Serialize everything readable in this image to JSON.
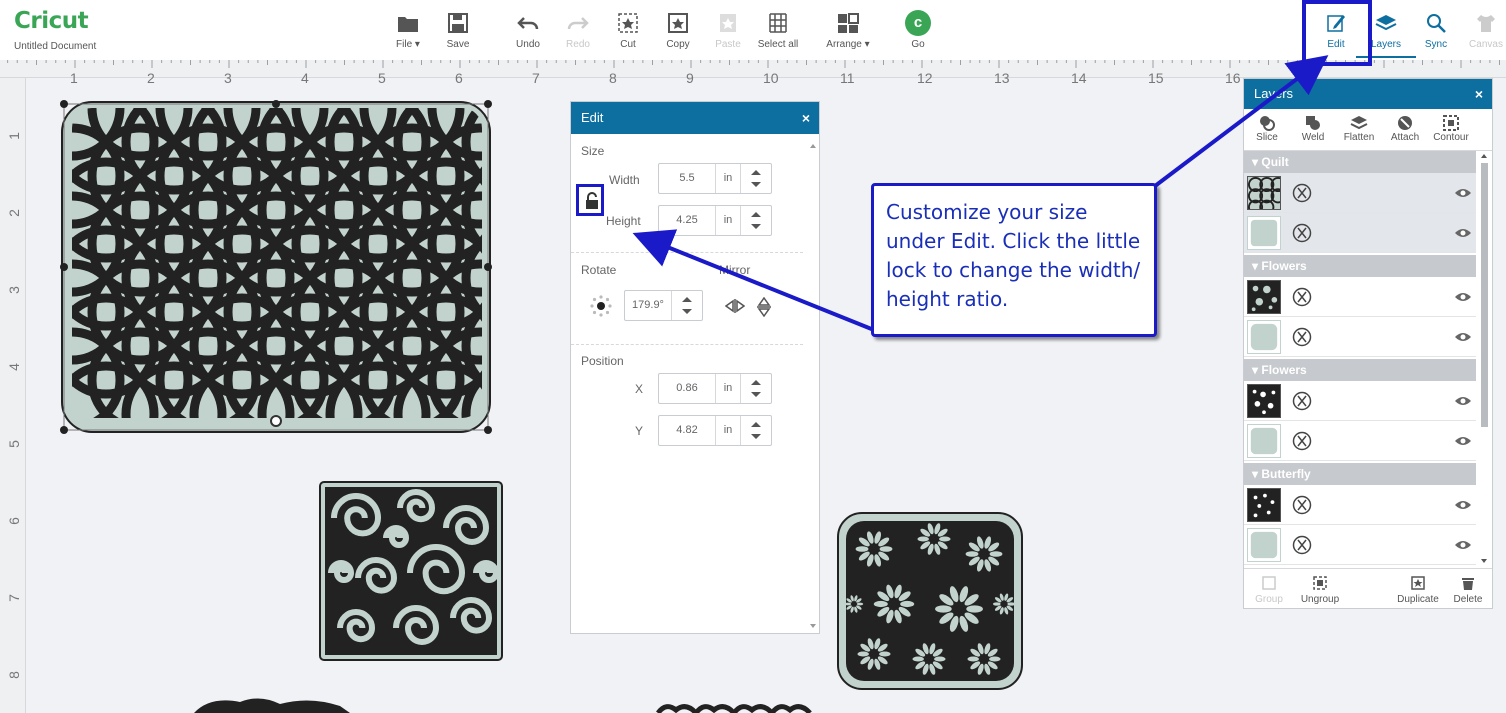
{
  "app": {
    "logo": "Cricut",
    "document_name": "Untitled Document"
  },
  "toolbar": {
    "file": "File",
    "save": "Save",
    "undo": "Undo",
    "redo": "Redo",
    "cut": "Cut",
    "copy": "Copy",
    "paste": "Paste",
    "select_all": "Select all",
    "arrange": "Arrange",
    "go": "Go",
    "go_glyph": "c",
    "edit": "Edit",
    "layers": "Layers",
    "sync": "Sync",
    "canvas": "Canvas"
  },
  "ruler": {
    "h_numbers": [
      "1",
      "2",
      "3",
      "4",
      "5",
      "6",
      "7",
      "8",
      "9",
      "10",
      "11",
      "12",
      "13",
      "14",
      "15",
      "16"
    ],
    "v_numbers": [
      "1",
      "2",
      "3",
      "4",
      "5",
      "6",
      "7",
      "8"
    ]
  },
  "edit_panel": {
    "title": "Edit",
    "close": "×",
    "size_title": "Size",
    "width_label": "Width",
    "width_value": "5.5",
    "height_label": "Height",
    "height_value": "4.25",
    "unit": "in",
    "rotate_title": "Rotate",
    "rotate_value": "179.9°",
    "mirror_title": "Mirror",
    "position_title": "Position",
    "x_label": "X",
    "x_value": "0.86",
    "y_label": "Y",
    "y_value": "4.82"
  },
  "layers_panel": {
    "title": "Layers",
    "close": "×",
    "tools": [
      "Slice",
      "Weld",
      "Flatten",
      "Attach",
      "Contour"
    ],
    "groups": [
      {
        "name": "Quilt"
      },
      {
        "name": "Flowers"
      },
      {
        "name": "Flowers"
      },
      {
        "name": "Butterfly"
      }
    ],
    "bottom": {
      "group": "Group",
      "ungroup": "Ungroup",
      "duplicate": "Duplicate",
      "delete": "Delete"
    }
  },
  "callout": {
    "text_lines": [
      "Customize your size",
      "under Edit. Click the little",
      "lock to change the width/",
      "height ratio."
    ]
  },
  "colors": {
    "accent": "#0d6ea0",
    "brand": "#3aa655",
    "annotation": "#1a1ac8",
    "shape_fill": "#c2d3ce"
  }
}
